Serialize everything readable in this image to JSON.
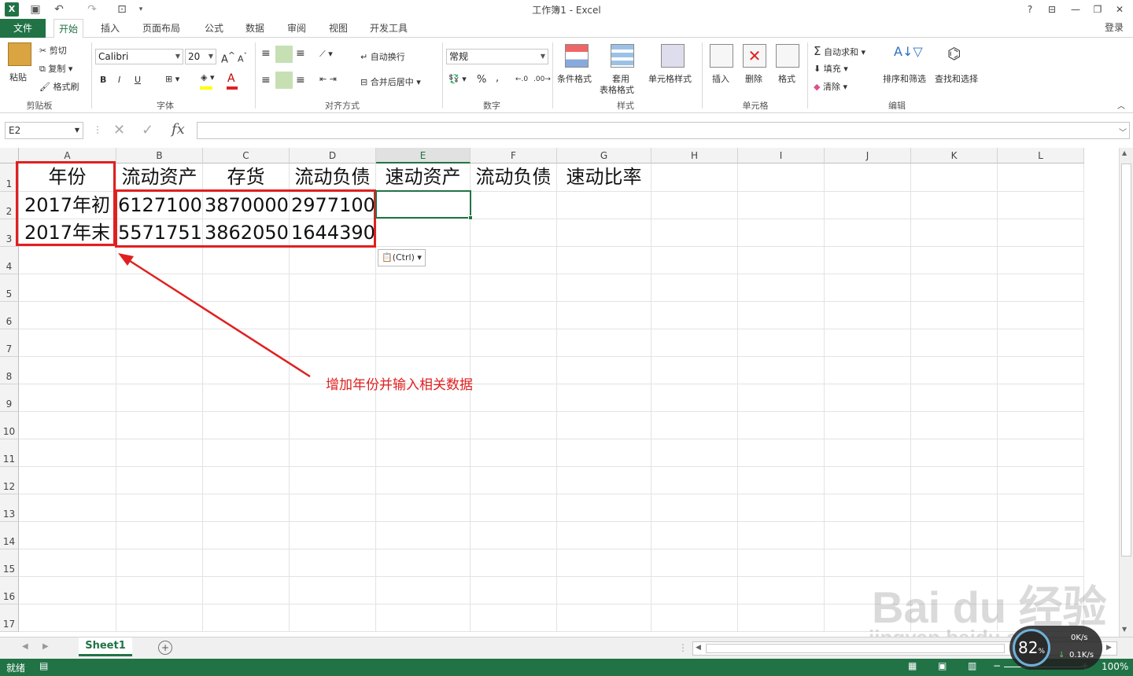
{
  "window": {
    "title": "工作簿1 - Excel",
    "login": "登录"
  },
  "menu": {
    "file": "文件",
    "tabs": [
      "开始",
      "插入",
      "页面布局",
      "公式",
      "数据",
      "审阅",
      "视图",
      "开发工具"
    ]
  },
  "ribbon": {
    "clipboard": {
      "paste": "粘贴",
      "cut": "剪切",
      "copy": "复制",
      "format_painter": "格式刷",
      "label": "剪贴板"
    },
    "font": {
      "name": "Calibri",
      "size": "20",
      "bold": "B",
      "italic": "I",
      "underline": "U",
      "font_color": "A",
      "label": "字体"
    },
    "alignment": {
      "wrap": "自动换行",
      "merge": "合并后居中",
      "label": "对齐方式"
    },
    "number": {
      "format": "常规",
      "percent": "%",
      "comma": ",",
      "label": "数字"
    },
    "styles": {
      "conditional": "条件格式",
      "table_line1": "套用",
      "table_line2": "表格格式",
      "cell_styles": "单元格样式",
      "label": "样式"
    },
    "cells": {
      "insert": "插入",
      "delete": "删除",
      "format": "格式",
      "label": "单元格"
    },
    "editing": {
      "autosum": "自动求和",
      "fill": "填充",
      "clear": "清除",
      "sort": "排序和筛选",
      "find": "查找和选择",
      "label": "编辑"
    }
  },
  "formula_bar": {
    "name_box": "E2",
    "fx": "fx",
    "value": ""
  },
  "grid": {
    "columns": [
      "A",
      "B",
      "C",
      "D",
      "E",
      "F",
      "G",
      "H",
      "I",
      "J",
      "K",
      "L"
    ],
    "selected_column": "E",
    "rows": [
      "1",
      "2",
      "3",
      "4",
      "5",
      "6",
      "7",
      "8",
      "9",
      "10",
      "11",
      "12",
      "13",
      "14",
      "15",
      "16",
      "17"
    ],
    "cells": {
      "A1": "年份",
      "B1": "流动资产",
      "C1": "存货",
      "D1": "流动负债",
      "E1": "速动资产",
      "F1": "流动负债",
      "G1": "速动比率",
      "A2": "2017年初",
      "B2": "6127100",
      "C2": "3870000",
      "D2": "2977100",
      "A3": "2017年末",
      "B3": "5571751",
      "C3": "3862050",
      "D3": "1644390"
    }
  },
  "paste_options": "(Ctrl)",
  "annotation": "增加年份并输入相关数据",
  "sheets": {
    "active": "Sheet1"
  },
  "status": {
    "ready": "就绪",
    "zoom": "100%"
  },
  "watermark": {
    "brand": "Bai du 经验",
    "url": "jingyan.baidu.com"
  },
  "net_badge": {
    "percent": "82",
    "up": "0K/s",
    "down": "0.1K/s"
  },
  "colors": {
    "excel_green": "#217346",
    "annotation_red": "#e02020"
  }
}
